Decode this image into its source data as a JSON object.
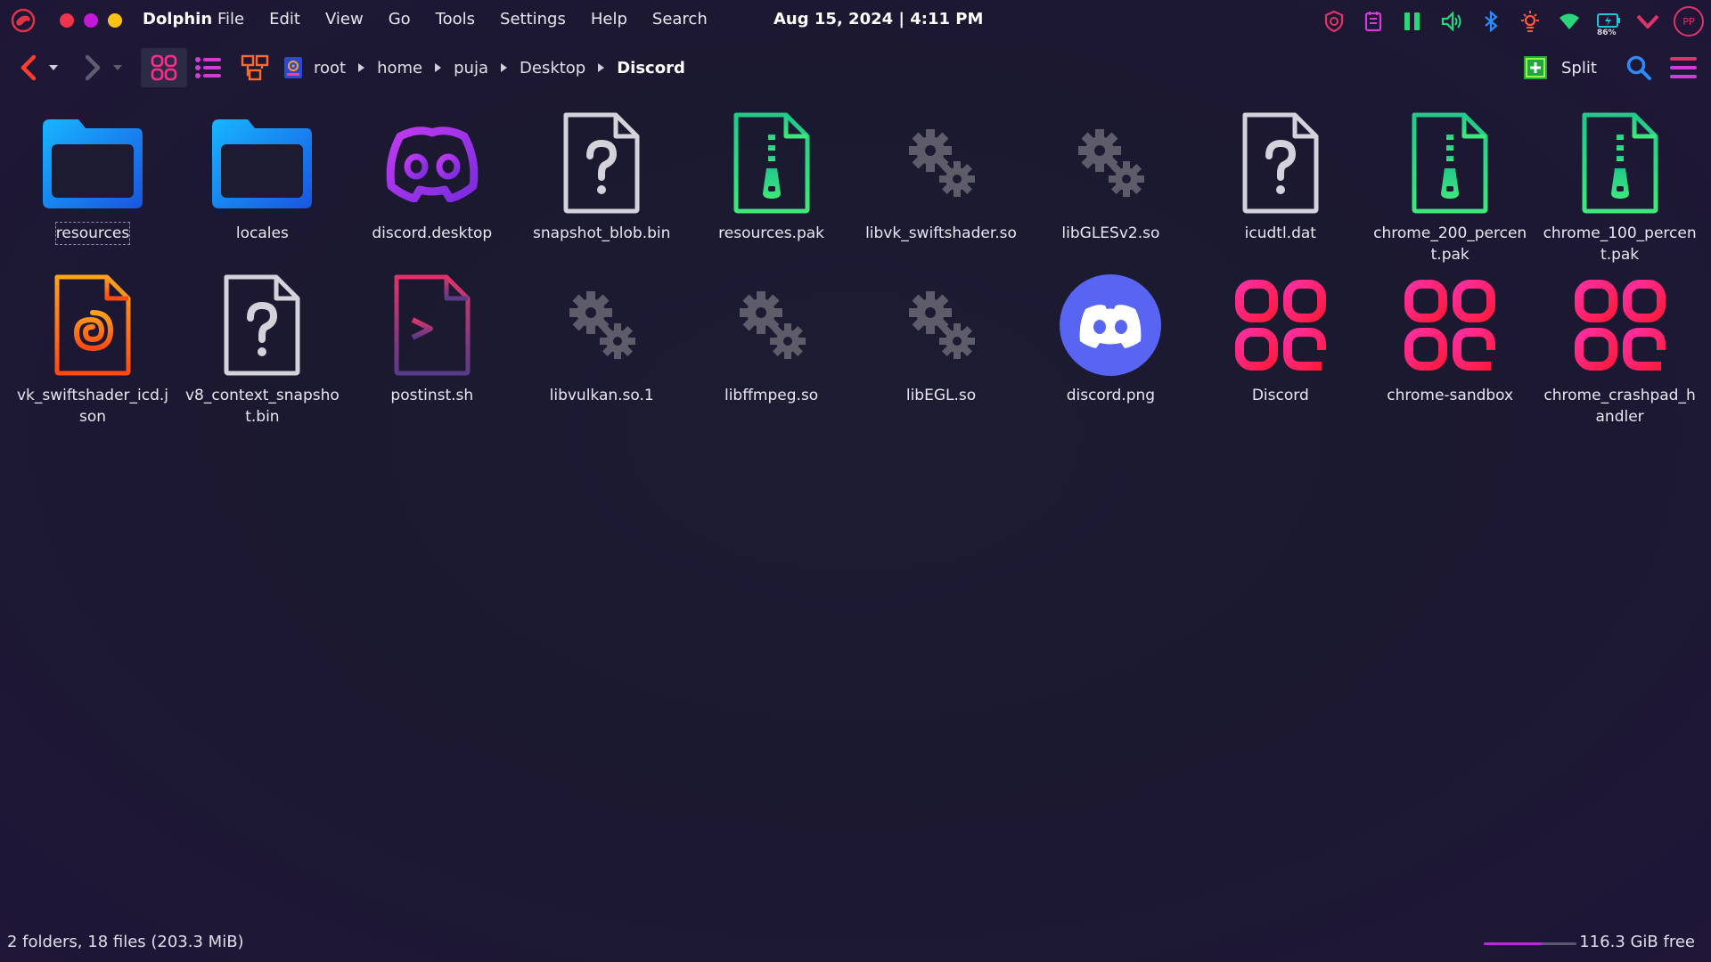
{
  "panel": {
    "app_name": "Dolphin",
    "menu": [
      "File",
      "Edit",
      "View",
      "Go",
      "Tools",
      "Settings",
      "Help",
      "Search"
    ],
    "clock": "Aug 15, 2024 | 4:11 PM",
    "tray_icons": [
      "shield-icon",
      "notes-icon",
      "pause-icon",
      "volume-icon",
      "bluetooth-icon",
      "brightness-icon",
      "wifi-icon",
      "battery-icon",
      "chevron-down-icon"
    ],
    "battery_percent": "86%",
    "avatar_initials": "PP",
    "window_dots": {
      "close": "#f0344c",
      "maximize": "#c21ad4",
      "minimize": "#ffc213"
    }
  },
  "toolbar": {
    "breadcrumb": [
      "root",
      "home",
      "puja",
      "Desktop",
      "Discord"
    ],
    "split_label": "Split"
  },
  "files": [
    {
      "name": "resources",
      "icon": "folder-icon",
      "focused": true
    },
    {
      "name": "locales",
      "icon": "folder-icon"
    },
    {
      "name": "discord.desktop",
      "icon": "discord-logo-icon"
    },
    {
      "name": "snapshot_blob.bin",
      "icon": "unknown-file-icon"
    },
    {
      "name": "resources.pak",
      "icon": "archive-file-icon"
    },
    {
      "name": "libvk_swiftshader.so",
      "icon": "library-gears-icon"
    },
    {
      "name": "libGLESv2.so",
      "icon": "library-gears-icon"
    },
    {
      "name": "icudtl.dat",
      "icon": "unknown-file-icon"
    },
    {
      "name": "chrome_200_percent.pak",
      "icon": "archive-file-icon"
    },
    {
      "name": "chrome_100_percent.pak",
      "icon": "archive-file-icon"
    },
    {
      "name": "vk_swiftshader_icd.json",
      "icon": "json-file-icon"
    },
    {
      "name": "v8_context_snapshot.bin",
      "icon": "unknown-file-icon"
    },
    {
      "name": "postinst.sh",
      "icon": "shell-script-icon"
    },
    {
      "name": "libvulkan.so.1",
      "icon": "library-gears-icon"
    },
    {
      "name": "libffmpeg.so",
      "icon": "library-gears-icon"
    },
    {
      "name": "libEGL.so",
      "icon": "library-gears-icon"
    },
    {
      "name": "discord.png",
      "icon": "discord-image-icon"
    },
    {
      "name": "Discord",
      "icon": "executable-icon"
    },
    {
      "name": "chrome-sandbox",
      "icon": "executable-icon"
    },
    {
      "name": "chrome_crashpad_handler",
      "icon": "executable-icon"
    }
  ],
  "status": {
    "summary": "2 folders, 18 files (203.3 MiB)",
    "free_space": "116.3 GiB free",
    "used_fraction": 0.63
  },
  "colors": {
    "accent": "#e0336a",
    "folder": "#1e88e5",
    "discord": "#5865f2",
    "archive": "#2bd67b",
    "executable": "#ff1f6e"
  }
}
